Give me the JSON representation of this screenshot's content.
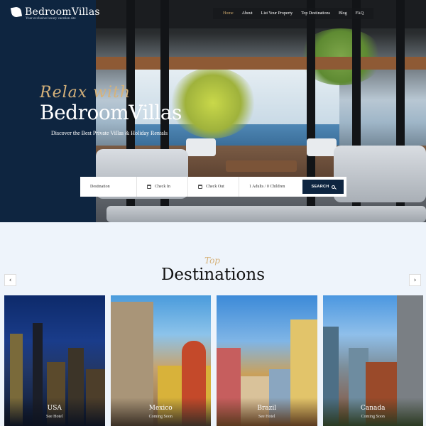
{
  "brand": {
    "name": "BedroomVillas",
    "tagline": "Your exclusive luxury vacation site"
  },
  "nav": {
    "items": [
      {
        "label": "Home",
        "active": true
      },
      {
        "label": "About"
      },
      {
        "label": "List Your Property"
      },
      {
        "label": "Top Destinations"
      },
      {
        "label": "Blog"
      },
      {
        "label": "FAQ"
      }
    ]
  },
  "hero": {
    "script": "Relax with",
    "title": "BedroomVillas",
    "subtitle": "Discover the Best Private Villas & Holiday Rentals"
  },
  "search": {
    "destination": "Destination",
    "check_in": "Check In",
    "check_out": "Check Out",
    "guests": "1 Adults / 0 Children",
    "button": "SEARCH"
  },
  "destinations": {
    "script": "Top",
    "title": "Destinations",
    "cards": [
      {
        "name": "USA",
        "sub": "See Hotel"
      },
      {
        "name": "Mexico",
        "sub": "Coming Soon"
      },
      {
        "name": "Brazil",
        "sub": "See Hotel"
      },
      {
        "name": "Canada",
        "sub": "Coming Soon"
      }
    ]
  },
  "arrows": {
    "prev": "‹",
    "next": "›"
  },
  "colors": {
    "navy": "#0e2540",
    "gold": "#d6b27a",
    "page_bg": "#eef4fb"
  }
}
